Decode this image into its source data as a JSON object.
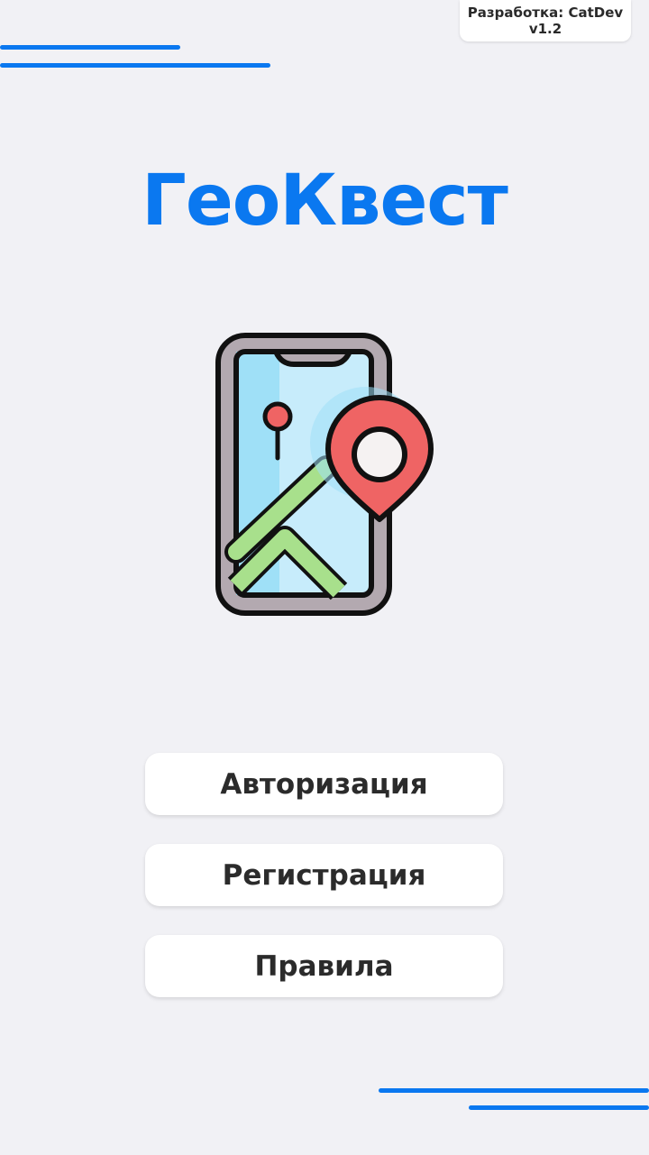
{
  "developer": {
    "label": "Разработка: CatDev",
    "version": "v1.2"
  },
  "app": {
    "title": "ГеоКвест",
    "logo_icon": "phone-map-pin-icon"
  },
  "menu": [
    {
      "label": "Авторизация"
    },
    {
      "label": "Регистрация"
    },
    {
      "label": "Правила"
    }
  ],
  "colors": {
    "accent": "#0a78f0",
    "background": "#f1f1f5",
    "button": "#ffffff",
    "text": "#2b2b2b"
  }
}
